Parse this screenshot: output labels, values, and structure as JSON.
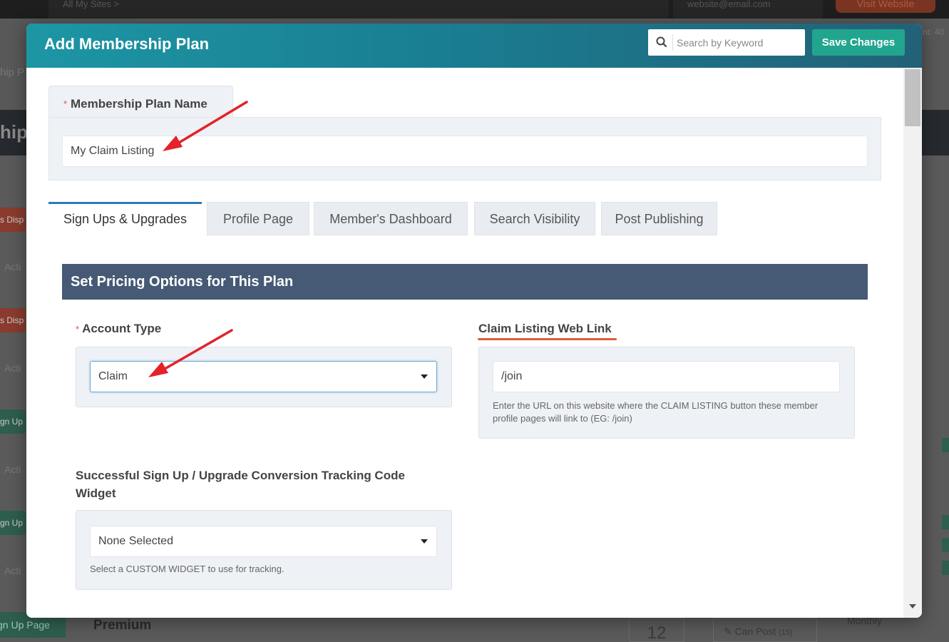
{
  "background": {
    "sites_label": "All My Sites  >",
    "email_label": "website@email.com",
    "visit_label": "Visit Website",
    "left_label": "hip P",
    "header_text": "hip",
    "right_text": "nt: 40",
    "pill_red_1": "s Disp",
    "pill_red_2": "s Disp",
    "acti_label": "Acti",
    "pill_green_1": "gn Up",
    "pill_green_2": "gn Up",
    "signup_page": "gn Up Page",
    "premium": "Premium",
    "number": "12",
    "can_post": "Can Post",
    "can_post_count": "(15)",
    "monthly": "Monthly"
  },
  "modal": {
    "title": "Add Membership Plan",
    "search_placeholder": "Search by Keyword",
    "save_label": "Save Changes"
  },
  "plan_name": {
    "label": "Membership Plan Name",
    "value": "My Claim Listing"
  },
  "tabs": [
    {
      "label": "Sign Ups & Upgrades",
      "active": true
    },
    {
      "label": "Profile Page",
      "active": false
    },
    {
      "label": "Member's Dashboard",
      "active": false
    },
    {
      "label": "Search Visibility",
      "active": false
    },
    {
      "label": "Post Publishing",
      "active": false
    }
  ],
  "section": {
    "title": "Set Pricing Options for This Plan"
  },
  "account_type": {
    "label": "Account Type",
    "value": "Claim"
  },
  "claim_link": {
    "label": "Claim Listing Web Link",
    "value": "/join",
    "help": "Enter the URL on this website where the CLAIM LISTING button these member profile pages will link to (EG: /join)"
  },
  "tracking": {
    "label": "Successful Sign Up / Upgrade Conversion Tracking Code Widget",
    "value": "None Selected",
    "help": "Select a CUSTOM WIDGET to use for tracking."
  },
  "colors": {
    "header_start": "#1d96a4",
    "header_end": "#226178",
    "save_button": "#22a58e",
    "section_bar": "#465a75",
    "active_tab_border": "#2b7bb9",
    "required_star": "#d9534f",
    "annotation_arrow": "#e3222a"
  }
}
